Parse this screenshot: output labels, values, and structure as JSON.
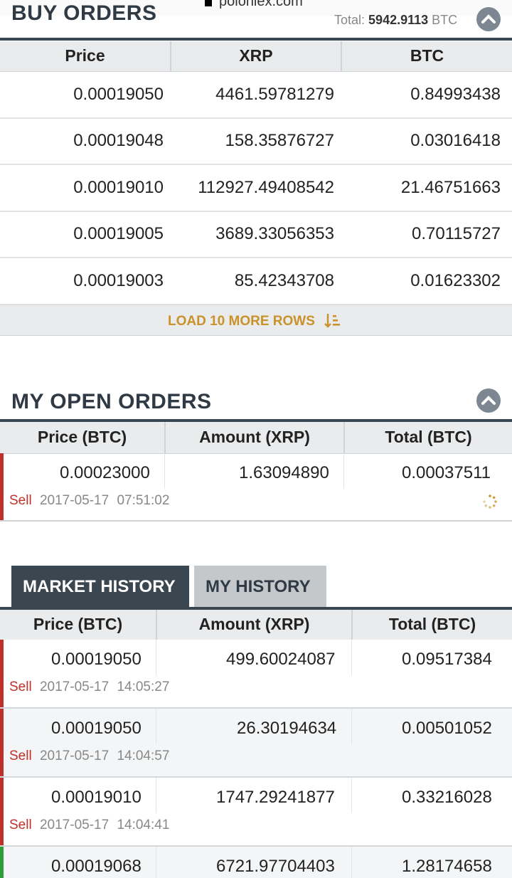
{
  "browser": {
    "url": "poloniex.com"
  },
  "buy_orders": {
    "title": "BUY ORDERS",
    "total_label": "Total:",
    "total_value": "5942.9113",
    "total_unit": "BTC",
    "columns": [
      "Price",
      "XRP",
      "BTC"
    ],
    "rows": [
      [
        "0.00019050",
        "4461.59781279",
        "0.84993438"
      ],
      [
        "0.00019048",
        "158.35876727",
        "0.03016418"
      ],
      [
        "0.00019010",
        "112927.49408542",
        "21.46751663"
      ],
      [
        "0.00019005",
        "3689.33056353",
        "0.70115727"
      ],
      [
        "0.00019003",
        "85.42343708",
        "0.01623302"
      ]
    ],
    "load_more_label": "LOAD 10 MORE ROWS"
  },
  "open_orders": {
    "title": "MY OPEN ORDERS",
    "columns": [
      "Price (BTC)",
      "Amount (XRP)",
      "Total (BTC)"
    ],
    "rows": [
      {
        "price": "0.00023000",
        "amount": "1.63094890",
        "total": "0.00037511",
        "side": "Sell",
        "date": "2017-05-17",
        "time": "07:51:02"
      }
    ]
  },
  "history": {
    "tabs": [
      "MARKET HISTORY",
      "MY HISTORY"
    ],
    "columns": [
      "Price (BTC)",
      "Amount (XRP)",
      "Total (BTC)"
    ],
    "rows": [
      {
        "price": "0.00019050",
        "amount": "499.60024087",
        "total": "0.09517384",
        "side": "Sell",
        "date": "2017-05-17",
        "time": "14:05:27"
      },
      {
        "price": "0.00019050",
        "amount": "26.30194634",
        "total": "0.00501052",
        "side": "Sell",
        "date": "2017-05-17",
        "time": "14:04:57"
      },
      {
        "price": "0.00019010",
        "amount": "1747.29241877",
        "total": "0.33216028",
        "side": "Sell",
        "date": "2017-05-17",
        "time": "14:04:41"
      },
      {
        "price": "0.00019068",
        "amount": "6721.97704403",
        "total": "1.28174658",
        "side": "Buy",
        "date": "",
        "time": ""
      }
    ]
  },
  "colors": {
    "sell": "#c0302a",
    "buy": "#2e9c3a",
    "accent": "#c9922a",
    "header_dark": "#3a4650"
  },
  "icons": [
    "lock-icon",
    "collapse-up-icon",
    "sort-rows-icon",
    "loading-spinner-icon"
  ]
}
